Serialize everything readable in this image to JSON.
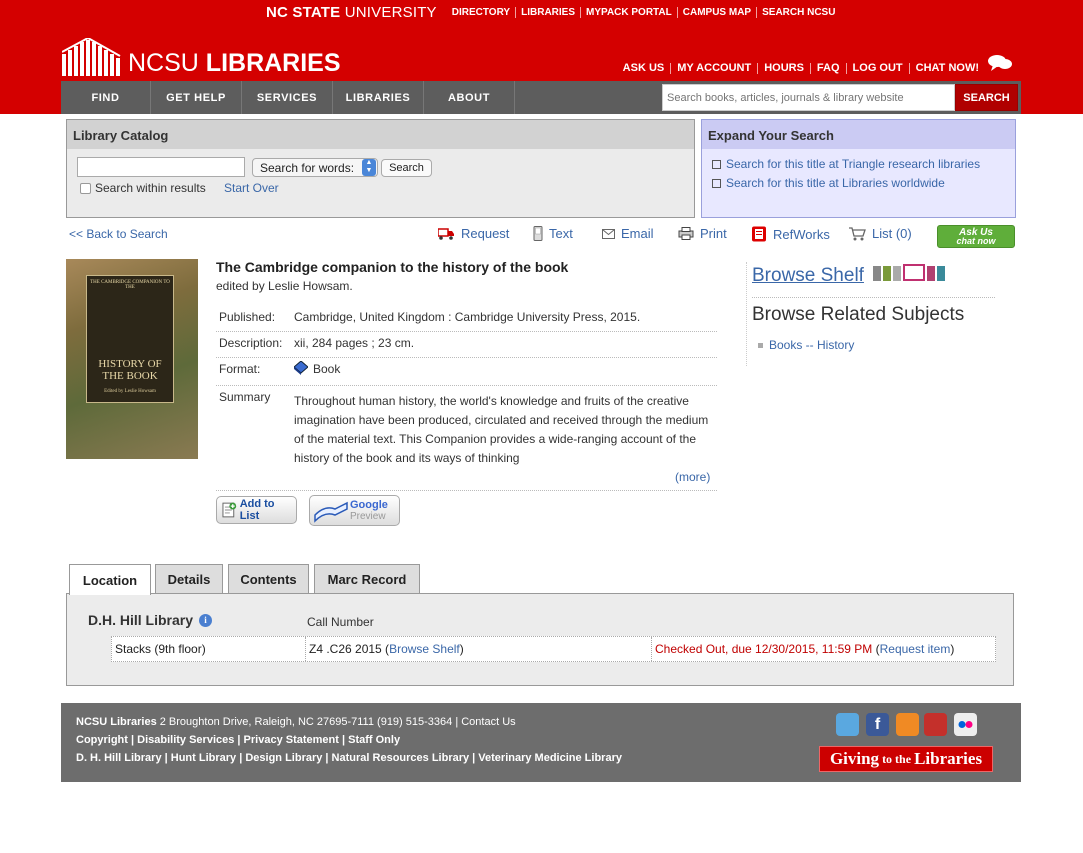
{
  "university": {
    "brand_bold": "NC STATE",
    "brand_light": " UNIVERSITY",
    "links": [
      "DIRECTORY",
      "LIBRARIES",
      "MYPACK PORTAL",
      "CAMPUS MAP",
      "SEARCH NCSU"
    ]
  },
  "logo": {
    "text_light": "NCSU ",
    "text_bold": "LIBRARIES"
  },
  "utility_links": [
    "ASK US",
    "MY ACCOUNT",
    "HOURS",
    "FAQ",
    "LOG OUT",
    "CHAT NOW!"
  ],
  "nav": [
    "FIND",
    "GET HELP",
    "SERVICES",
    "LIBRARIES",
    "ABOUT"
  ],
  "site_search": {
    "placeholder": "Search books, articles, journals & library website",
    "button": "SEARCH"
  },
  "catalog": {
    "heading": "Library Catalog",
    "select_value": "Search for words:",
    "search_button": "Search",
    "within_label": "Search within results",
    "start_over": "Start Over"
  },
  "expand": {
    "heading": "Expand Your Search",
    "links": [
      "Search for this title at Triangle research libraries",
      "Search for this title at Libraries worldwide"
    ]
  },
  "back_link": "<< Back to Search",
  "actions": {
    "request": "Request",
    "text": "Text",
    "email": "Email",
    "print": "Print",
    "refworks": "RefWorks",
    "list": "List (0)",
    "askus_line1": "Ask Us",
    "askus_line2": "chat now"
  },
  "cover": {
    "top": "THE CAMBRIDGE COMPANION TO THE",
    "title_line1": "HISTORY OF",
    "title_line2": "THE BOOK",
    "editor": "Edited by Leslie Howsam"
  },
  "record": {
    "title": "The Cambridge companion to the history of the book",
    "editor": "edited by Leslie Howsam.",
    "fields": [
      {
        "key": "Published:",
        "value": "Cambridge, United Kingdom : Cambridge University Press, 2015."
      },
      {
        "key": "Description:",
        "value": "xii, 284 pages ; 23 cm."
      },
      {
        "key": "Format:",
        "value": "Book"
      },
      {
        "key": "Summary",
        "value": ""
      }
    ],
    "summary": "Throughout human history, the world's knowledge and fruits of the creative imagination have been produced, circulated and received through the medium of the material text. This Companion provides a wide-ranging account of the history of the book and its ways of thinking",
    "more": "(more)",
    "add_to_list": "Add to List",
    "google_preview_line1": "Google",
    "google_preview_line2": "Preview"
  },
  "sidebar": {
    "browse_shelf": "Browse Shelf",
    "related_heading": "Browse Related Subjects",
    "related_item": "Books -- History"
  },
  "tabs": [
    "Location",
    "Details",
    "Contents",
    "Marc Record"
  ],
  "location": {
    "library": "D.H. Hill Library",
    "call_number_heading": "Call Number",
    "shelf": "Stacks (9th floor)",
    "call_number": "Z4 .C26 2015",
    "browse_link": "Browse Shelf",
    "status": "Checked Out, due 12/30/2015, 11:59 PM",
    "request_link": "Request item"
  },
  "footer": {
    "line1_bold": "NCSU Libraries",
    "line1": " 2 Broughton Drive, Raleigh, NC 27695-7111 (919) 515-3364 | Contact Us",
    "line2": "Copyright | Disability Services | Privacy Statement | Staff Only",
    "line3": "D. H. Hill Library | Hunt Library | Design Library | Natural Resources Library | Veterinary Medicine Library",
    "giving_big1": "Giving",
    "giving_small": "to the",
    "giving_big2": "Libraries"
  },
  "colors": {
    "brand_red": "#d40000",
    "nav_gray": "#5d5d5d",
    "link_blue": "#3a67a8",
    "status_red": "#c00000"
  }
}
